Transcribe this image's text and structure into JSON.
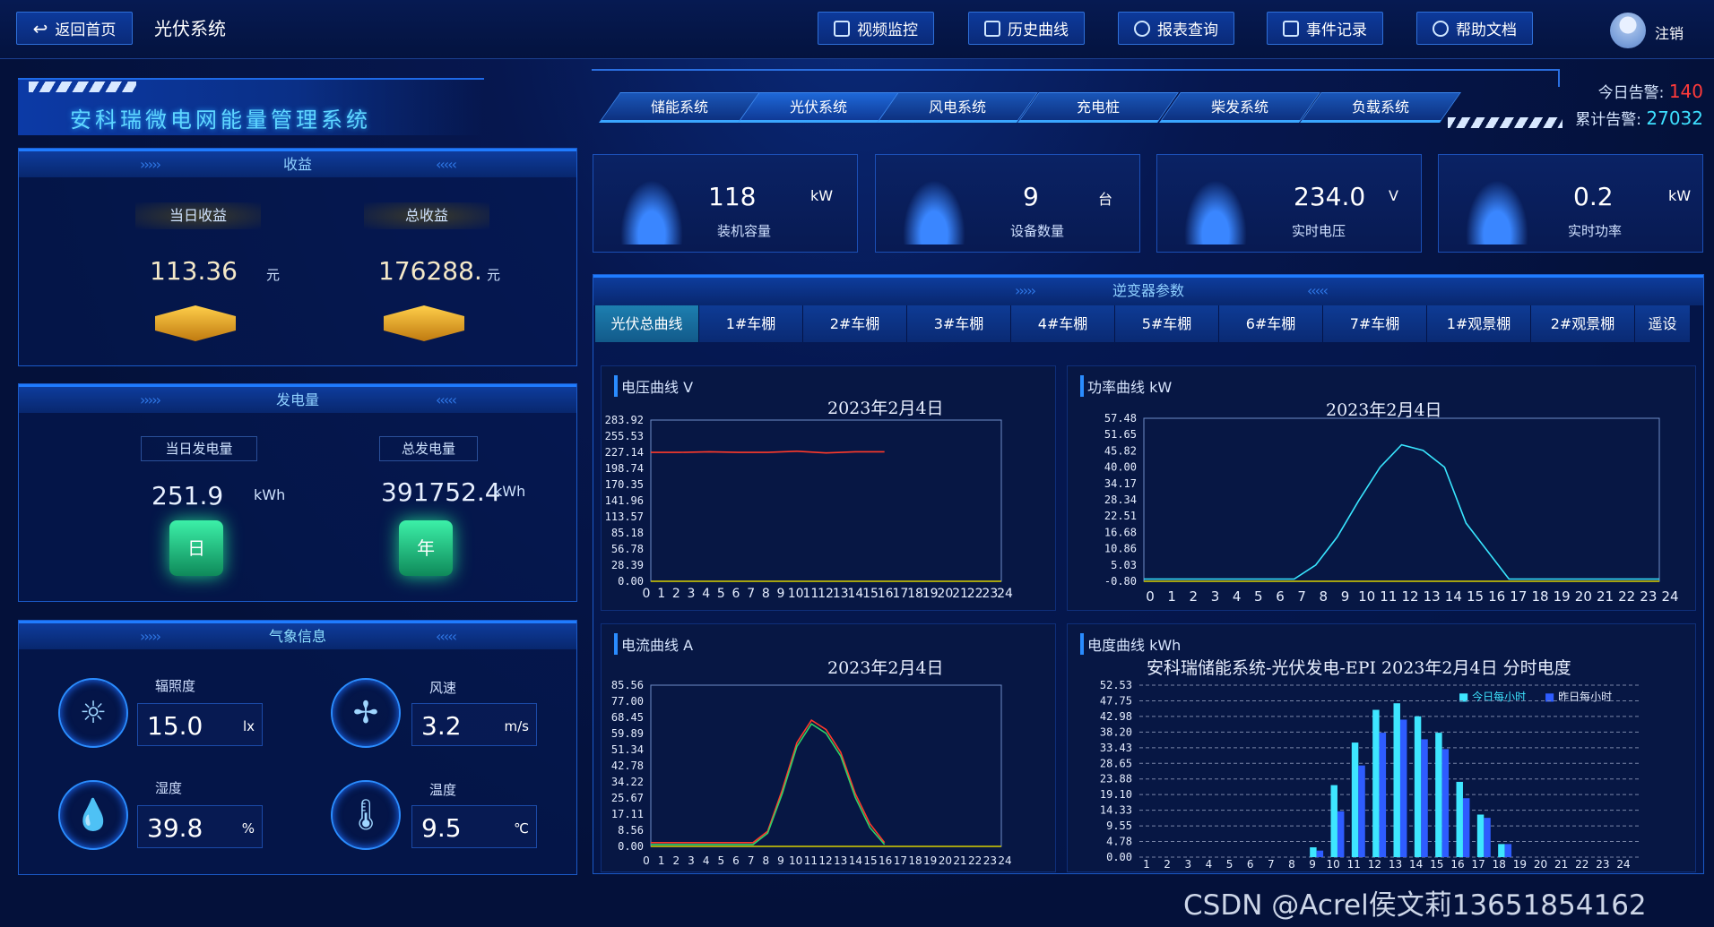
{
  "topbar": {
    "back": "返回首页",
    "page": "光伏系统",
    "buttons": [
      "视频监控",
      "历史曲线",
      "报表查询",
      "事件记录",
      "帮助文档"
    ],
    "logout": "注销"
  },
  "header": {
    "system_name": "安科瑞微电网能量管理系统",
    "nav": [
      "储能系统",
      "光伏系统",
      "风电系统",
      "充电桩",
      "柴发系统",
      "负载系统"
    ],
    "today_alarm_label": "今日告警:",
    "today_alarm": "140",
    "total_alarm_label": "累计告警:",
    "total_alarm": "27032"
  },
  "income": {
    "title": "收益",
    "today_label": "当日收益",
    "today_value": "113.36",
    "today_unit": "元",
    "total_label": "总收益",
    "total_value": "176288.",
    "total_unit": "元"
  },
  "generation": {
    "title": "发电量",
    "today_label": "当日发电量",
    "today_value": "251.9",
    "today_unit": "kWh",
    "total_label": "总发电量",
    "total_value": "391752.4",
    "total_unit": "kWh",
    "day_icon": "日",
    "year_icon": "年"
  },
  "weather": {
    "title": "气象信息",
    "items": [
      {
        "label": "辐照度",
        "value": "15.0",
        "unit": "lx"
      },
      {
        "label": "风速",
        "value": "3.2",
        "unit": "m/s"
      },
      {
        "label": "湿度",
        "value": "39.8",
        "unit": "%"
      },
      {
        "label": "温度",
        "value": "9.5",
        "unit": "℃"
      }
    ]
  },
  "kpis": [
    {
      "value": "118",
      "unit": "kW",
      "label": "装机容量",
      "icon": "battery-icon"
    },
    {
      "value": "9",
      "unit": "台",
      "label": "设备数量",
      "icon": "device-icon"
    },
    {
      "value": "234.0",
      "unit": "V",
      "label": "实时电压",
      "icon": "gauge-icon"
    },
    {
      "value": "0.2",
      "unit": "kW",
      "label": "实时功率",
      "icon": "pulse-icon"
    }
  ],
  "inverter": {
    "title": "逆变器参数",
    "tabs": [
      "光伏总曲线",
      "1#车棚",
      "2#车棚",
      "3#车棚",
      "4#车棚",
      "5#车棚",
      "6#车棚",
      "7#车棚",
      "1#观景棚",
      "2#观景棚",
      "遥设"
    ]
  },
  "watermark": "CSDN @Acrel侯文莉13651854162",
  "chart_data": [
    {
      "type": "line",
      "title": "电压曲线 V",
      "date": "2023年2月4日",
      "ylabels": [
        "283.92",
        "255.53",
        "227.14",
        "198.74",
        "170.35",
        "141.96",
        "113.57",
        "85.18",
        "56.78",
        "28.39",
        "0.00"
      ],
      "ylim": [
        0,
        283.92
      ],
      "x": [
        "0",
        "1",
        "2",
        "3",
        "4",
        "5",
        "6",
        "7",
        "8",
        "9",
        "10",
        "11",
        "12",
        "13",
        "14",
        "15",
        "16",
        "17",
        "18",
        "19",
        "20",
        "21",
        "22",
        "23",
        "24"
      ],
      "series": [
        {
          "color": "#ff3a2a",
          "points": [
            [
              0,
              227
            ],
            [
              2,
              227
            ],
            [
              4,
              228
            ],
            [
              6,
              227
            ],
            [
              8,
              227
            ],
            [
              10,
              229
            ],
            [
              12,
              226
            ],
            [
              14,
              228
            ],
            [
              16,
              228
            ]
          ]
        }
      ]
    },
    {
      "type": "line",
      "title": "功率曲线 kW",
      "date": "2023年2月4日",
      "ylabels": [
        "57.48",
        "51.65",
        "45.82",
        "40.00",
        "34.17",
        "28.34",
        "22.51",
        "16.68",
        "10.86",
        "5.03",
        "-0.80"
      ],
      "ylim": [
        -0.8,
        57.48
      ],
      "x": [
        "0",
        "1",
        "2",
        "3",
        "4",
        "5",
        "6",
        "7",
        "8",
        "9",
        "10",
        "11",
        "12",
        "13",
        "14",
        "15",
        "16",
        "17",
        "18",
        "19",
        "20",
        "21",
        "22",
        "23",
        "24"
      ],
      "series": [
        {
          "color": "#39e6ff",
          "points": [
            [
              0,
              0
            ],
            [
              7,
              0
            ],
            [
              8,
              5
            ],
            [
              9,
              15
            ],
            [
              10,
              28
            ],
            [
              11,
              40
            ],
            [
              12,
              48
            ],
            [
              13,
              46
            ],
            [
              14,
              40
            ],
            [
              14.5,
              30
            ],
            [
              15,
              20
            ],
            [
              16,
              10
            ],
            [
              17,
              0
            ],
            [
              24,
              0
            ]
          ]
        }
      ]
    },
    {
      "type": "line",
      "title": "电流曲线 A",
      "date": "2023年2月4日",
      "ylabels": [
        "85.56",
        "77.00",
        "68.45",
        "59.89",
        "51.34",
        "42.78",
        "34.22",
        "25.67",
        "17.11",
        "8.56",
        "0.00"
      ],
      "ylim": [
        0,
        85.56
      ],
      "x": [
        "0",
        "1",
        "2",
        "3",
        "4",
        "5",
        "6",
        "7",
        "8",
        "9",
        "10",
        "11",
        "12",
        "13",
        "14",
        "15",
        "16",
        "17",
        "18",
        "19",
        "20",
        "21",
        "22",
        "23",
        "24"
      ],
      "series": [
        {
          "color": "#ff3a2a",
          "points": [
            [
              0,
              2
            ],
            [
              7,
              2
            ],
            [
              8,
              8
            ],
            [
              9,
              30
            ],
            [
              10,
              55
            ],
            [
              11,
              67
            ],
            [
              12,
              62
            ],
            [
              13,
              50
            ],
            [
              14,
              28
            ],
            [
              15,
              12
            ],
            [
              16,
              2
            ]
          ]
        },
        {
          "color": "#2fd06a",
          "points": [
            [
              0,
              1
            ],
            [
              7,
              1
            ],
            [
              8,
              7
            ],
            [
              9,
              28
            ],
            [
              10,
              53
            ],
            [
              11,
              65
            ],
            [
              12,
              60
            ],
            [
              13,
              48
            ],
            [
              14,
              26
            ],
            [
              15,
              10
            ],
            [
              16,
              1
            ]
          ]
        }
      ]
    },
    {
      "type": "bar",
      "title": "电度曲线 kWh",
      "chart_title": "安科瑞储能系统-光伏发电-EPI 2023年2月4日 分时电度",
      "ylabels": [
        "52.53",
        "47.75",
        "42.98",
        "38.20",
        "33.43",
        "28.65",
        "23.88",
        "19.10",
        "14.33",
        "9.55",
        "4.78",
        "0.00"
      ],
      "ylim": [
        0,
        52.53
      ],
      "categories": [
        "1",
        "2",
        "3",
        "4",
        "5",
        "6",
        "7",
        "8",
        "9",
        "10",
        "11",
        "12",
        "13",
        "14",
        "15",
        "16",
        "17",
        "18",
        "19",
        "20",
        "21",
        "22",
        "23",
        "24"
      ],
      "series": [
        {
          "name": "今日每小时",
          "color": "#3ee6ff",
          "values": [
            0,
            0,
            0,
            0,
            0,
            0,
            0,
            0,
            3,
            22,
            35,
            45,
            47,
            43,
            38,
            23,
            13,
            4,
            0,
            0,
            0,
            0,
            0,
            0
          ]
        },
        {
          "name": "昨日每小时",
          "color": "#2e5cff",
          "values": [
            0,
            0,
            0,
            0,
            0,
            0,
            0,
            0,
            2,
            14,
            28,
            38,
            42,
            36,
            33,
            18,
            12,
            4,
            0,
            0,
            0,
            0,
            0,
            0
          ]
        }
      ]
    }
  ]
}
